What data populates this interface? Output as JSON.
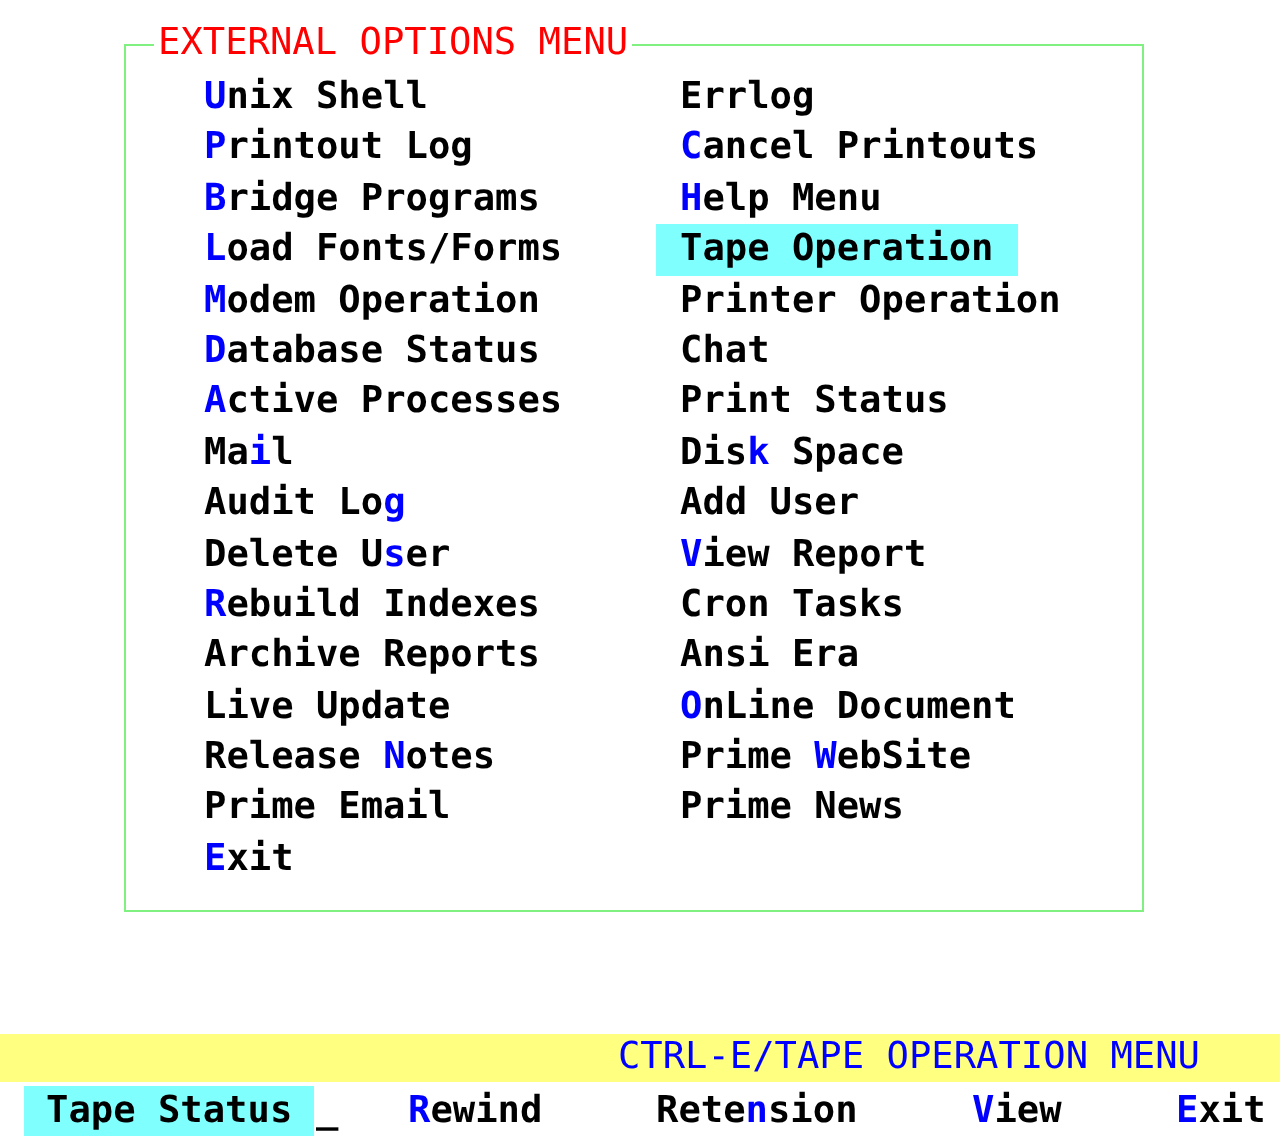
{
  "menu": {
    "title": "EXTERNAL OPTIONS MENU",
    "columns": [
      [
        {
          "key": "U",
          "post": "nix Shell",
          "selected": false
        },
        {
          "key": "P",
          "post": "rintout Log",
          "selected": false
        },
        {
          "key": "B",
          "post": "ridge Programs",
          "selected": false
        },
        {
          "key": "L",
          "post": "oad Fonts/Forms",
          "selected": false
        },
        {
          "key": "M",
          "post": "odem Operation",
          "selected": false
        },
        {
          "key": "D",
          "post": "atabase Status",
          "selected": false
        },
        {
          "key": "A",
          "post": "ctive Processes",
          "selected": false
        },
        {
          "pre": "Ma",
          "key": "i",
          "post": "l",
          "selected": false
        },
        {
          "pre": "Audit Lo",
          "key": "g",
          "selected": false
        },
        {
          "pre": "Delete U",
          "key": "s",
          "post": "er",
          "selected": false
        },
        {
          "key": "R",
          "post": "ebuild Indexes",
          "selected": false
        },
        {
          "pre": "Archive Reports",
          "selected": false
        },
        {
          "pre": "Live Update",
          "selected": false
        },
        {
          "pre": "Release ",
          "key": "N",
          "post": "otes",
          "selected": false
        },
        {
          "pre": "Prime Email",
          "selected": false
        },
        {
          "key": "E",
          "post": "xit",
          "selected": false
        }
      ],
      [
        {
          "pre": "Errlog",
          "selected": false
        },
        {
          "key": "C",
          "post": "ancel Printouts",
          "selected": false
        },
        {
          "key": "H",
          "post": "elp Menu",
          "selected": false
        },
        {
          "pre": "Tape Operation",
          "selected": true
        },
        {
          "pre": "Printer Operation",
          "selected": false
        },
        {
          "pre": "Chat",
          "selected": false
        },
        {
          "pre": "Print Status",
          "selected": false
        },
        {
          "pre": "Dis",
          "key": "k",
          "post": " Space",
          "selected": false
        },
        {
          "pre": "Add User",
          "selected": false
        },
        {
          "key": "V",
          "post": "iew Report",
          "selected": false
        },
        {
          "pre": "Cron Tasks",
          "selected": false
        },
        {
          "pre": "Ansi Era",
          "selected": false
        },
        {
          "key": "O",
          "post": "nLine Document",
          "selected": false
        },
        {
          "pre": "Prime ",
          "key": "W",
          "post": "ebSite",
          "selected": false
        },
        {
          "pre": "Prime News",
          "selected": false
        }
      ]
    ]
  },
  "status_bar": {
    "title": "CTRL-E/TAPE OPERATION MENU",
    "cursor": "_",
    "items": [
      {
        "pre": "Tape Status",
        "selected": true
      },
      {
        "key": "R",
        "post": "ewind",
        "selected": false
      },
      {
        "pre": "Rete",
        "key": "n",
        "post": "sion",
        "selected": false
      },
      {
        "key": "V",
        "post": "iew",
        "selected": false
      },
      {
        "key": "E",
        "post": "xit",
        "selected": false
      }
    ]
  }
}
